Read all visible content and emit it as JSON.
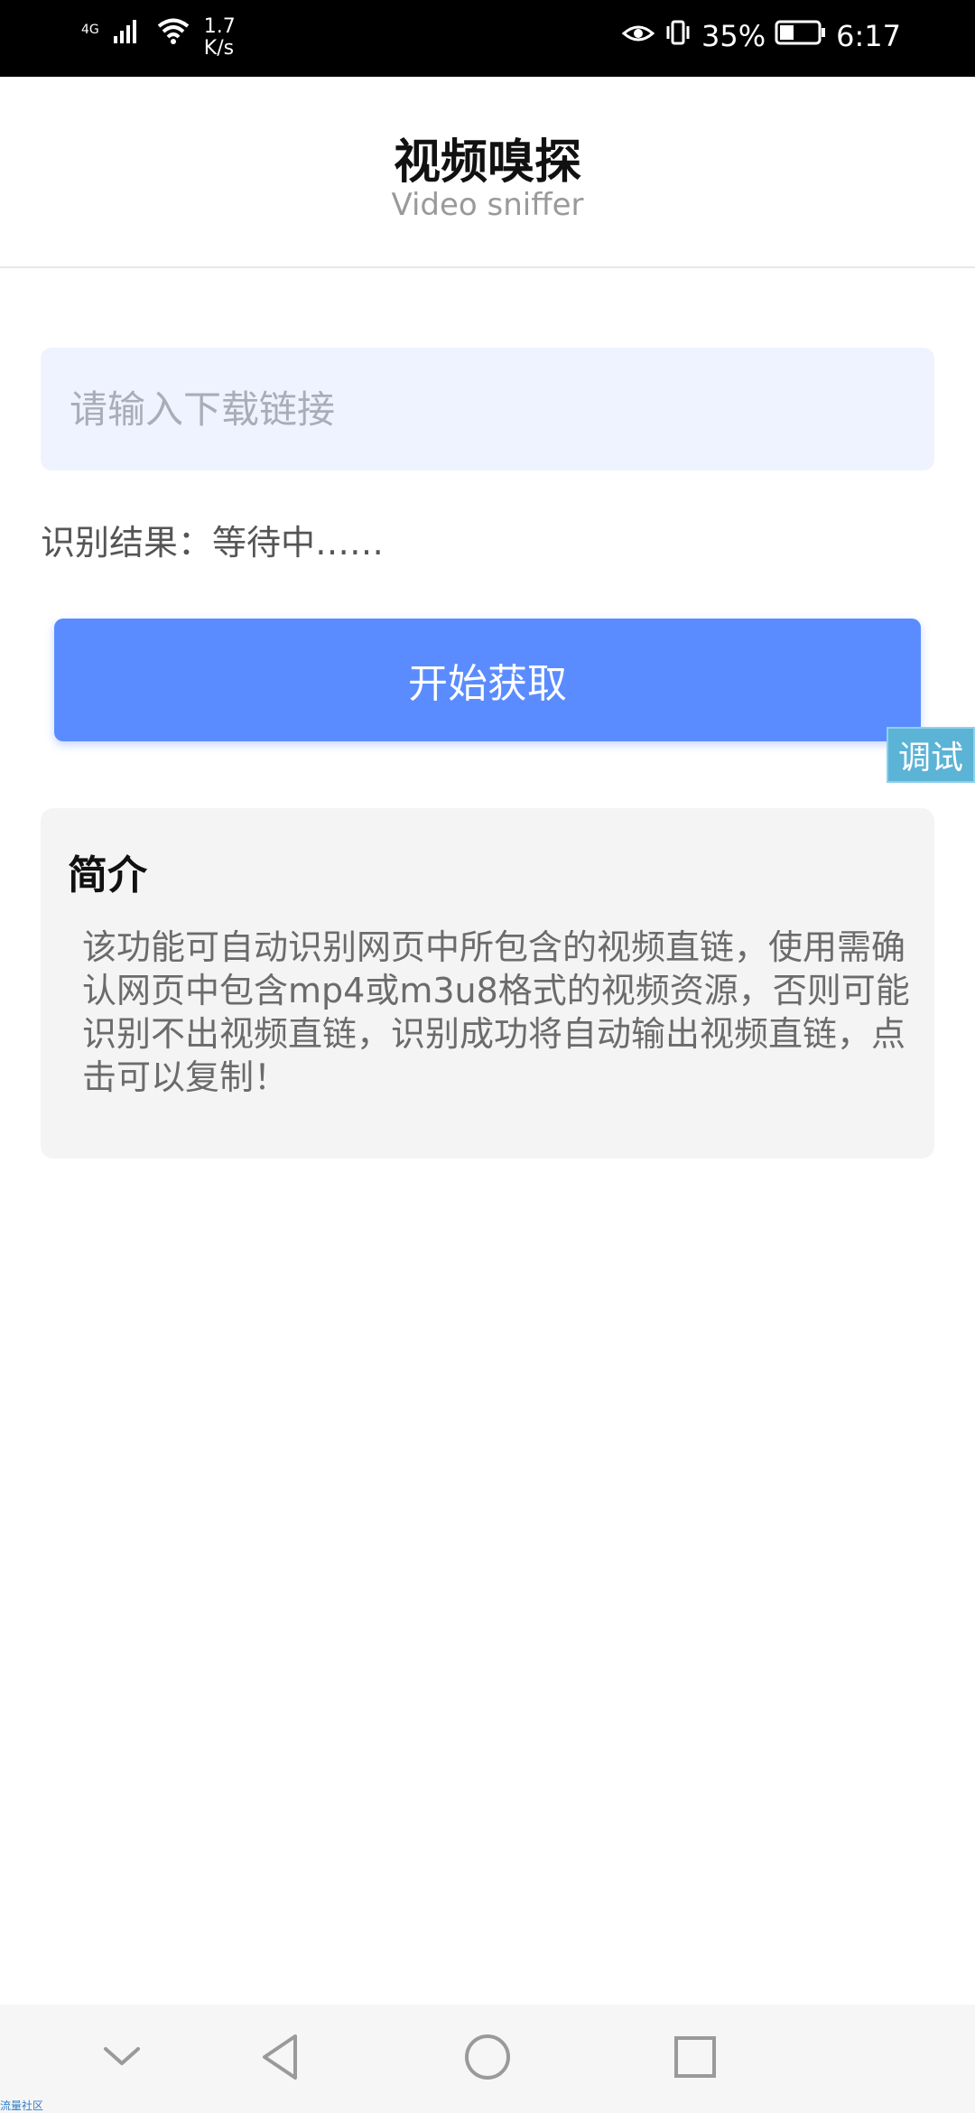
{
  "status_bar": {
    "network_type": "4G",
    "speed_value": "1.7",
    "speed_unit": "K/s",
    "battery": "35%",
    "time": "6:17"
  },
  "header": {
    "title": "视频嗅探",
    "subtitle": "Video sniffer"
  },
  "input": {
    "placeholder": "请输入下载链接",
    "value": ""
  },
  "result": {
    "text": "识别结果：等待中……"
  },
  "buttons": {
    "start_label": "开始获取",
    "debug_label": "调试"
  },
  "intro": {
    "title": "简介",
    "text": "该功能可自动识别网页中所包含的视频直链，使用需确认网页中包含mp4或m3u8格式的视频资源，否则可能识别不出视频直链，识别成功将自动输出视频直链，点击可以复制！"
  },
  "watermark": "流量社区",
  "colors": {
    "primary": "#5b8cff",
    "input_bg": "#eef3ff",
    "card_bg": "#f4f4f4",
    "debug_bg": "#5bb3d6"
  },
  "icons": {
    "status": [
      "signal-icon",
      "wifi-icon",
      "eye-icon",
      "vibrate-icon",
      "battery-icon"
    ],
    "nav": [
      "chevron-down-icon",
      "back-icon",
      "home-icon",
      "recents-icon"
    ]
  }
}
